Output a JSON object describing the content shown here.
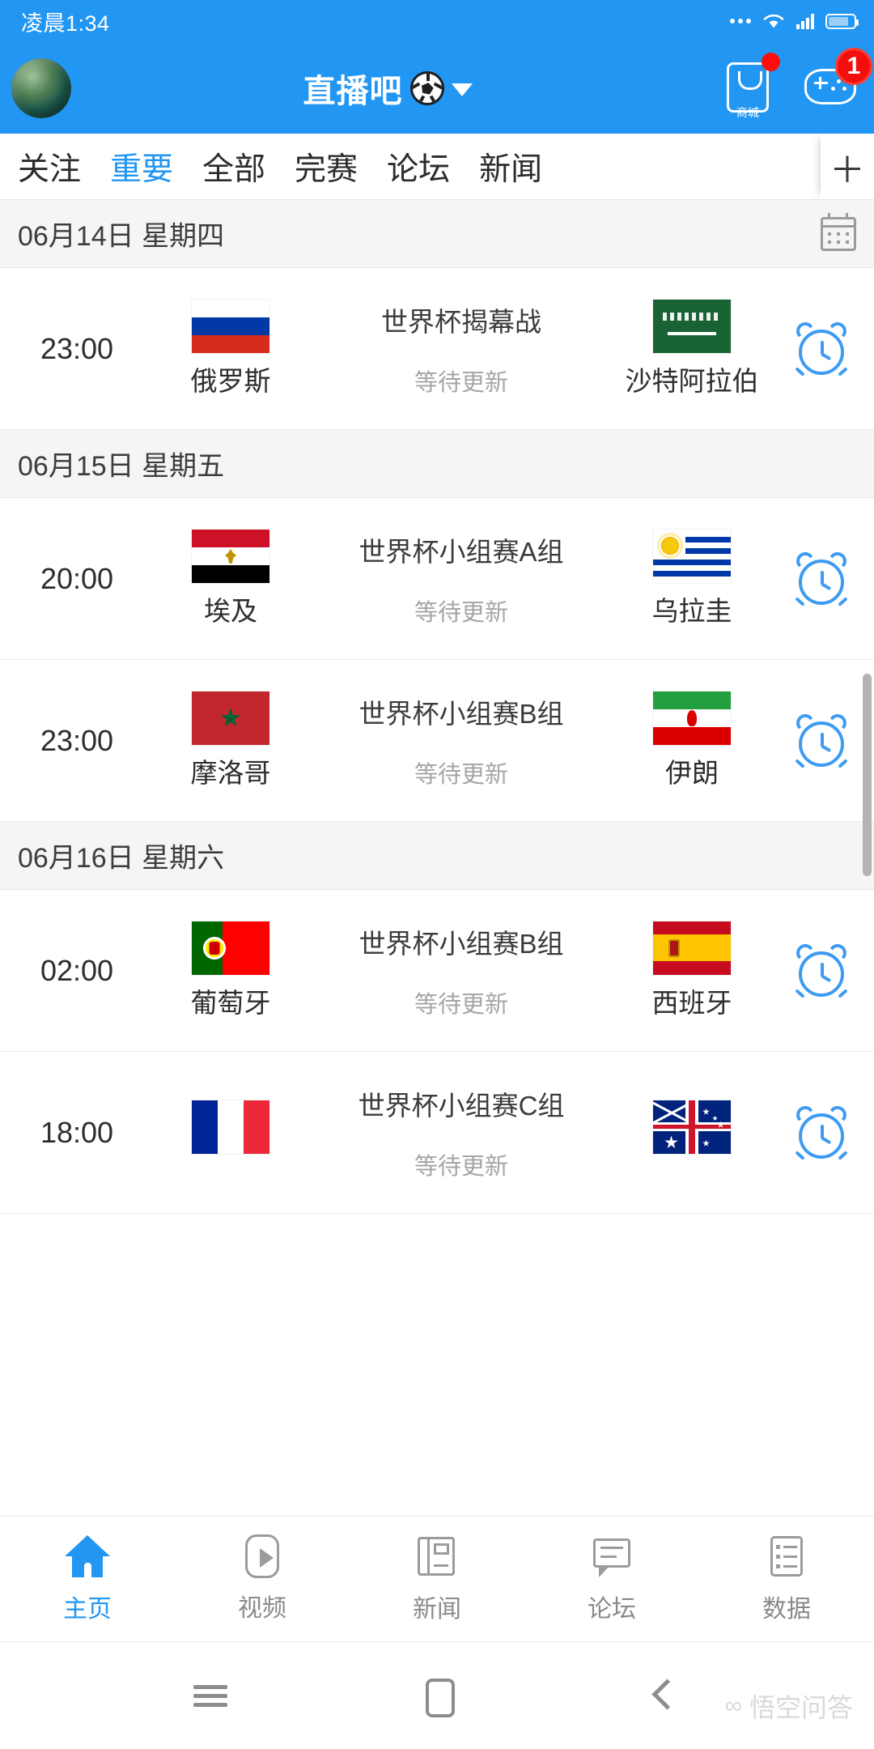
{
  "status_bar": {
    "time": "凌晨1:34",
    "icons": [
      "more-dots-icon",
      "wifi-icon",
      "signal-icon",
      "battery-icon"
    ]
  },
  "header": {
    "avatar": "user-avatar",
    "title": "直播吧",
    "title_icon": "soccer-ball-icon",
    "dropdown_icon": "caret-down-icon",
    "shop": {
      "icon": "shop-bag-icon",
      "label": "商城",
      "badge": ""
    },
    "game": {
      "icon": "gamepad-icon",
      "badge": "1"
    },
    "accent_color": "#2196f3"
  },
  "tabs": {
    "items": [
      {
        "label": "关注",
        "active": false
      },
      {
        "label": "重要",
        "active": true
      },
      {
        "label": "全部",
        "active": false
      },
      {
        "label": "完赛",
        "active": false
      },
      {
        "label": "论坛",
        "active": false
      },
      {
        "label": "新闻",
        "active": false
      }
    ],
    "add_label": "＋",
    "active_color": "#2196f3"
  },
  "sections": [
    {
      "date": "06月14日 星期四",
      "calendar_icon": "calendar-icon",
      "matches": [
        {
          "time": "23:00",
          "home": "俄罗斯",
          "home_flag": "flag-russia",
          "away": "沙特阿拉伯",
          "away_flag": "flag-saudi-arabia",
          "competition": "世界杯揭幕战",
          "status": "等待更新",
          "alarm_icon": "alarm-clock-icon"
        }
      ]
    },
    {
      "date": "06月15日 星期五",
      "calendar_icon": "calendar-icon",
      "matches": [
        {
          "time": "20:00",
          "home": "埃及",
          "home_flag": "flag-egypt",
          "away": "乌拉圭",
          "away_flag": "flag-uruguay",
          "competition": "世界杯小组赛A组",
          "status": "等待更新",
          "alarm_icon": "alarm-clock-icon"
        },
        {
          "time": "23:00",
          "home": "摩洛哥",
          "home_flag": "flag-morocco",
          "away": "伊朗",
          "away_flag": "flag-iran",
          "competition": "世界杯小组赛B组",
          "status": "等待更新",
          "alarm_icon": "alarm-clock-icon"
        }
      ]
    },
    {
      "date": "06月16日 星期六",
      "calendar_icon": "calendar-icon",
      "matches": [
        {
          "time": "02:00",
          "home": "葡萄牙",
          "home_flag": "flag-portugal",
          "away": "西班牙",
          "away_flag": "flag-spain",
          "competition": "世界杯小组赛B组",
          "status": "等待更新",
          "alarm_icon": "alarm-clock-icon"
        },
        {
          "time": "18:00",
          "home": "",
          "home_flag": "flag-france",
          "away": "",
          "away_flag": "flag-australia",
          "competition": "世界杯小组赛C组",
          "status": "等待更新",
          "alarm_icon": "alarm-clock-icon"
        }
      ]
    }
  ],
  "bottom_nav": {
    "items": [
      {
        "label": "主页",
        "icon": "home-icon",
        "active": true
      },
      {
        "label": "视频",
        "icon": "play-icon",
        "active": false
      },
      {
        "label": "新闻",
        "icon": "newspaper-icon",
        "active": false
      },
      {
        "label": "论坛",
        "icon": "chat-bubble-icon",
        "active": false
      },
      {
        "label": "数据",
        "icon": "list-icon",
        "active": false
      }
    ],
    "active_color": "#2196f3"
  },
  "system_bar": {
    "menu_icon": "menu-icon",
    "home_icon": "home-square-icon",
    "back_icon": "back-chevron-icon"
  },
  "watermark": {
    "mark": "∞",
    "text": "悟空问答"
  }
}
